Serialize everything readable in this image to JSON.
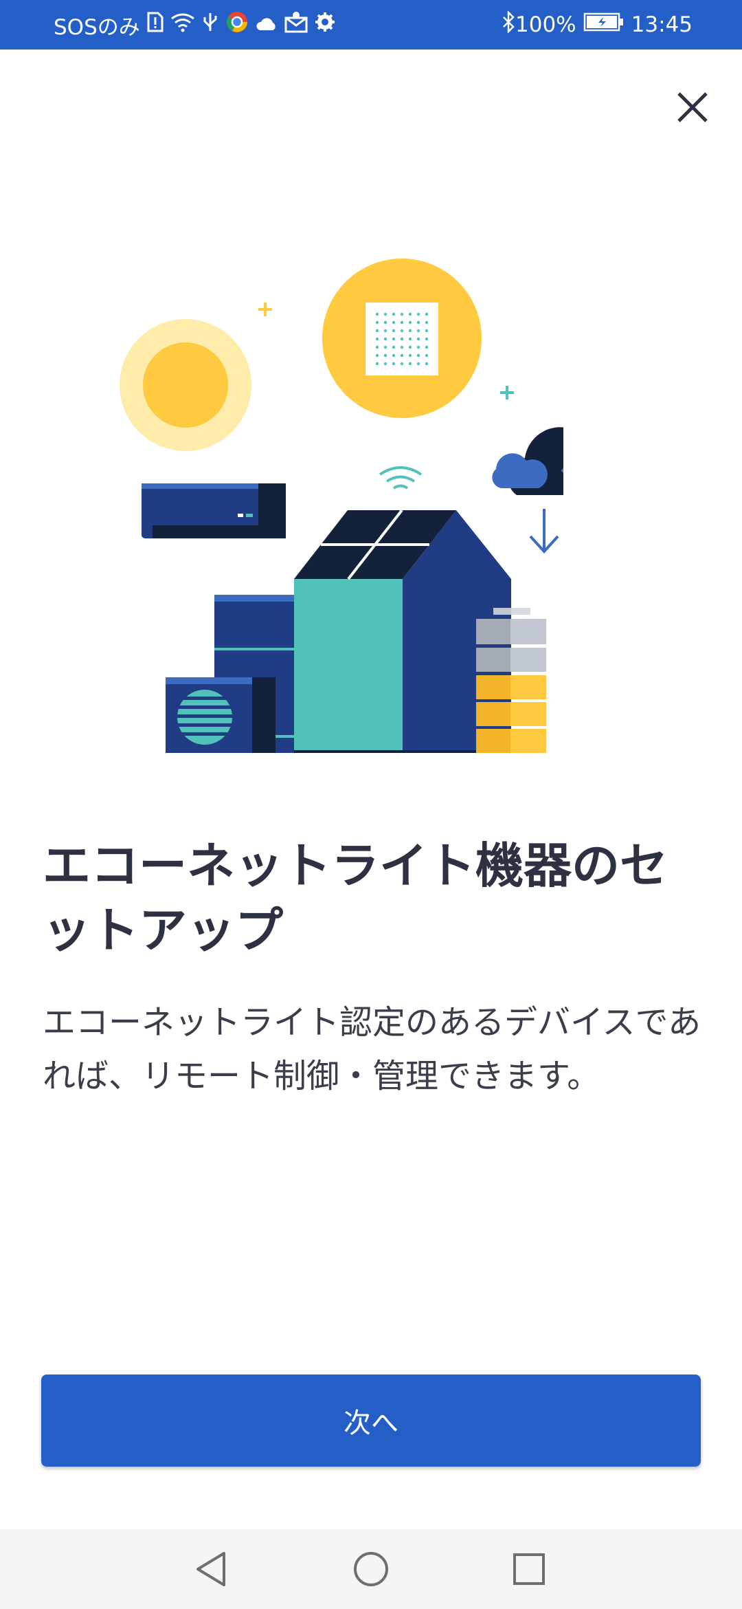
{
  "status_bar": {
    "carrier": "SOSのみ",
    "battery": "100%",
    "time": "13:45",
    "icons": [
      "sim-alert-icon",
      "wifi-icon",
      "usb-icon",
      "browser-icon",
      "cloud-icon",
      "mail-icon",
      "gear-icon",
      "bluetooth-icon",
      "battery-icon"
    ]
  },
  "close": {
    "icon": "close-icon"
  },
  "main": {
    "title": "エコーネットライト機器のセットアップ",
    "description": "エコーネットライト認定のあるデバイスであれば、リモート制御・管理できます。"
  },
  "next_button": {
    "label": "次へ"
  },
  "nav_bar": {
    "icons": [
      "back-icon",
      "home-icon",
      "recents-icon"
    ]
  },
  "colors": {
    "primary": "#235FC6",
    "navy": "#1F3C85",
    "dark_navy": "#14213A",
    "teal": "#52C1BA",
    "yellow": "#FFC940",
    "light_yellow": "#FFEBAA",
    "text_dark": "#2D3142"
  }
}
